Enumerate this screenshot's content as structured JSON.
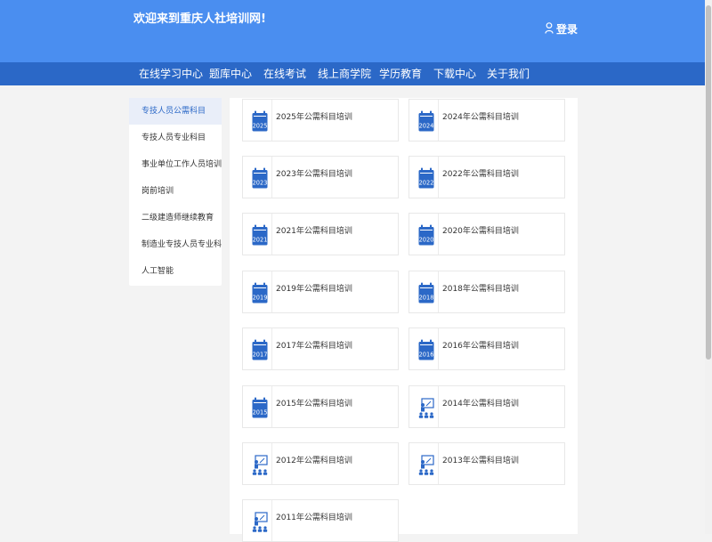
{
  "header": {
    "title": "欢迎来到重庆人社培训网!",
    "login_label": "登录"
  },
  "nav": {
    "items": [
      "在线学习中心",
      "题库中心",
      "在线考试",
      "线上商学院",
      "学历教育",
      "下载中心",
      "关于我们"
    ]
  },
  "sidebar": {
    "items": [
      "专技人员公需科目",
      "专技人员专业科目",
      "事业单位工作人员培训",
      "岗前培训",
      "二级建造师继续教育",
      "制造业专技人员专业科目",
      "人工智能"
    ],
    "active_index": 0
  },
  "courses": [
    {
      "title": "2025年公需科目培训",
      "year": "2025",
      "icon": "calendar-icon"
    },
    {
      "title": "2024年公需科目培训",
      "year": "2024",
      "icon": "calendar-icon"
    },
    {
      "title": "2023年公需科目培训",
      "year": "2023",
      "icon": "calendar-icon"
    },
    {
      "title": "2022年公需科目培训",
      "year": "2022",
      "icon": "calendar-icon"
    },
    {
      "title": "2021年公需科目培训",
      "year": "2021",
      "icon": "calendar-icon"
    },
    {
      "title": "2020年公需科目培训",
      "year": "2020",
      "icon": "calendar-icon"
    },
    {
      "title": "2019年公需科目培训",
      "year": "2019",
      "icon": "calendar-icon"
    },
    {
      "title": "2018年公需科目培训",
      "year": "2018",
      "icon": "calendar-icon"
    },
    {
      "title": "2017年公需科目培训",
      "year": "2017",
      "icon": "calendar-icon"
    },
    {
      "title": "2016年公需科目培训",
      "year": "2016",
      "icon": "calendar-icon"
    },
    {
      "title": "2015年公需科目培训",
      "year": "2015",
      "icon": "calendar-icon"
    },
    {
      "title": "2014年公需科目培训",
      "year": "",
      "icon": "classroom-icon"
    },
    {
      "title": "2012年公需科目培训",
      "year": "",
      "icon": "classroom-icon"
    },
    {
      "title": "2013年公需科目培训",
      "year": "",
      "icon": "classroom-icon"
    },
    {
      "title": "2011年公需科目培训",
      "year": "",
      "icon": "classroom-icon"
    }
  ],
  "colors": {
    "header_bg": "#4a8ef0",
    "nav_bg": "#2b68c7",
    "icon_blue": "#2b68c7",
    "active_bg": "#e9eef9"
  }
}
